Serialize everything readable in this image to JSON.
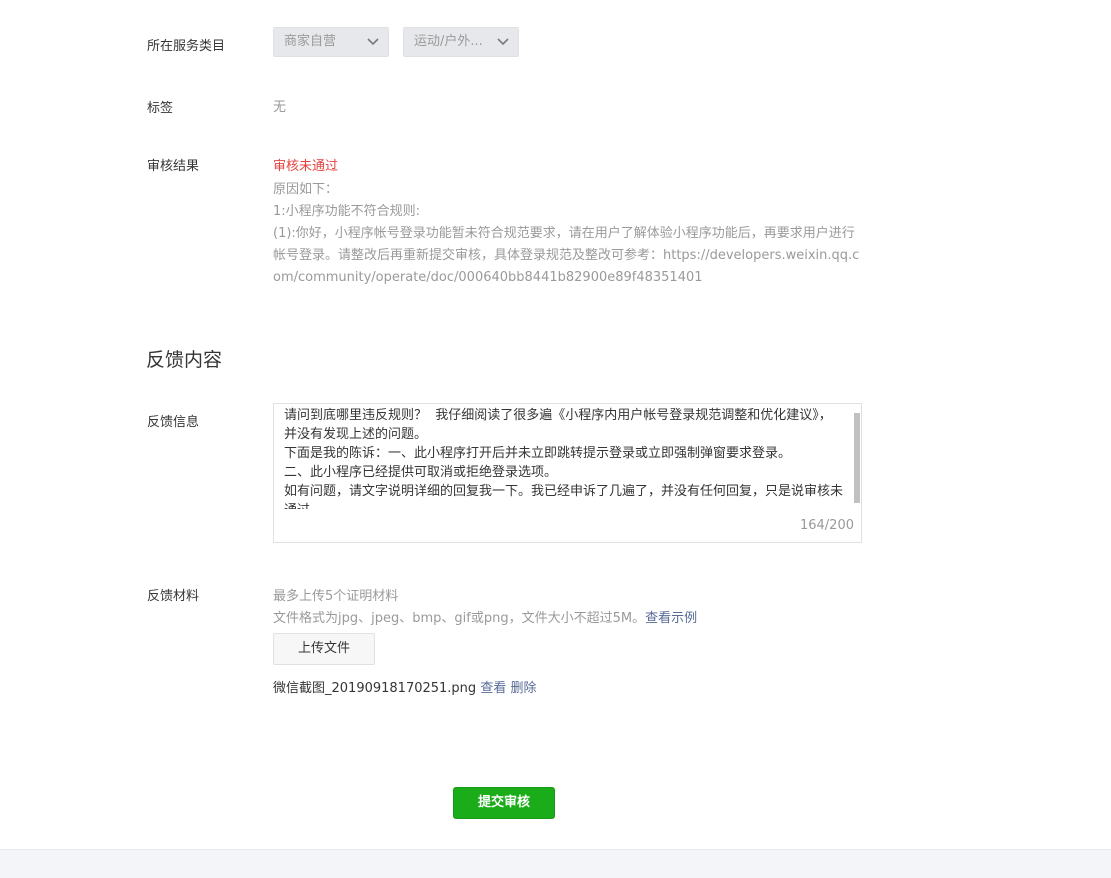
{
  "service_category": {
    "label": "所在服务类目",
    "primary": "商家自营",
    "secondary": "运动/户外..."
  },
  "tags": {
    "label": "标签",
    "value": "无"
  },
  "review_result": {
    "label": "审核结果",
    "status": "审核未通过",
    "reason_lines": [
      "原因如下：",
      "1:小程序功能不符合规则:",
      "(1):你好，小程序帐号登录功能暂未符合规范要求，请在用户了解体验小程序功能后，再要求用户进行帐号登录。请整改后再重新提交审核，具体登录规范及整改可参考：https://developers.weixin.qq.com/community/operate/doc/000640bb8441b82900e89f48351401"
    ]
  },
  "section_title": "反馈内容",
  "feedback_info": {
    "label": "反馈信息",
    "text": "请问到底哪里违反规则？  我仔细阅读了很多遍《小程序内用户帐号登录规范调整和优化建议》，  并没有发现上述的问题。\n下面是我的陈诉：一、此小程序打开后并未立即跳转提示登录或立即强制弹窗要求登录。\n二、此小程序已经提供可取消或拒绝登录选项。\n如有问题，请文字说明详细的回复我一下。我已经申诉了几遍了，并没有任何回复，只是说审核未通过",
    "counter": "164/200"
  },
  "feedback_material": {
    "label": "反馈材料",
    "hint1": "最多上传5个证明材料",
    "hint2": "文件格式为jpg、jpeg、bmp、gif或png，文件大小不超过5M。",
    "example_link": "查看示例",
    "upload_button": "上传文件",
    "file_name": "微信截图_20190918170251.png",
    "view_link": "查看",
    "delete_link": "删除"
  },
  "submit_button": "提交审核",
  "colors": {
    "primary_green": "#1aad19",
    "error_red": "#e64340",
    "link_blue": "#576b95"
  }
}
